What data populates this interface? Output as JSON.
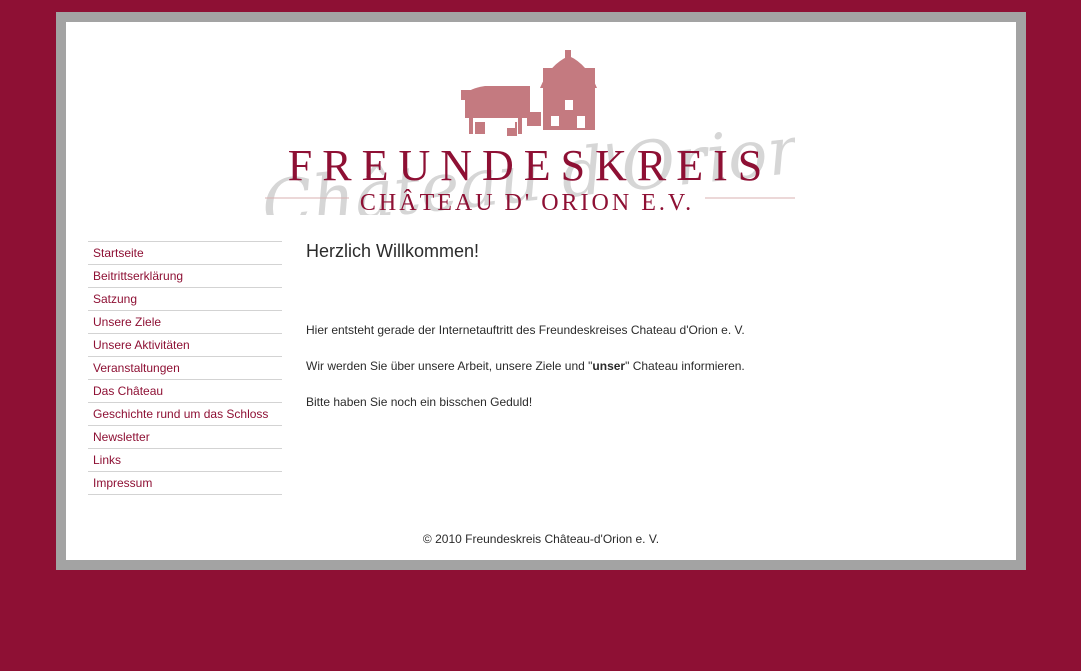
{
  "logo": {
    "title": "FREUNDESKREIS",
    "subtitle": "CHÂTEAU D' ORION E.V.",
    "script": "Château d'Orion",
    "colors": {
      "maroon": "#8e1034",
      "rose": "#c47a80",
      "gray": "#cfcfcf"
    }
  },
  "nav": {
    "items": [
      {
        "label": "Startseite"
      },
      {
        "label": "Beitrittserklärung"
      },
      {
        "label": "Satzung"
      },
      {
        "label": "Unsere Ziele"
      },
      {
        "label": "Unsere Aktivitäten"
      },
      {
        "label": "Veranstaltungen"
      },
      {
        "label": "Das Château"
      },
      {
        "label": "Geschichte rund um das Schloss"
      },
      {
        "label": "Newsletter"
      },
      {
        "label": "Links"
      },
      {
        "label": "Impressum"
      }
    ]
  },
  "content": {
    "heading": "Herzlich Willkommen!",
    "p1": "Hier entsteht gerade der Internetauftritt des Freundeskreises Chateau d'Orion e. V.",
    "p2_before": "Wir werden Sie über unsere Arbeit, unsere Ziele und \"",
    "p2_bold": "unser",
    "p2_after": "\" Chateau informieren.",
    "p3": "Bitte haben Sie noch ein bisschen Geduld!"
  },
  "footer": {
    "text": "© 2010 Freundeskreis Château-d'Orion e. V."
  },
  "colors": {
    "background": "#8e1034",
    "frame": "#a3a3a3",
    "link": "#8e1034"
  }
}
